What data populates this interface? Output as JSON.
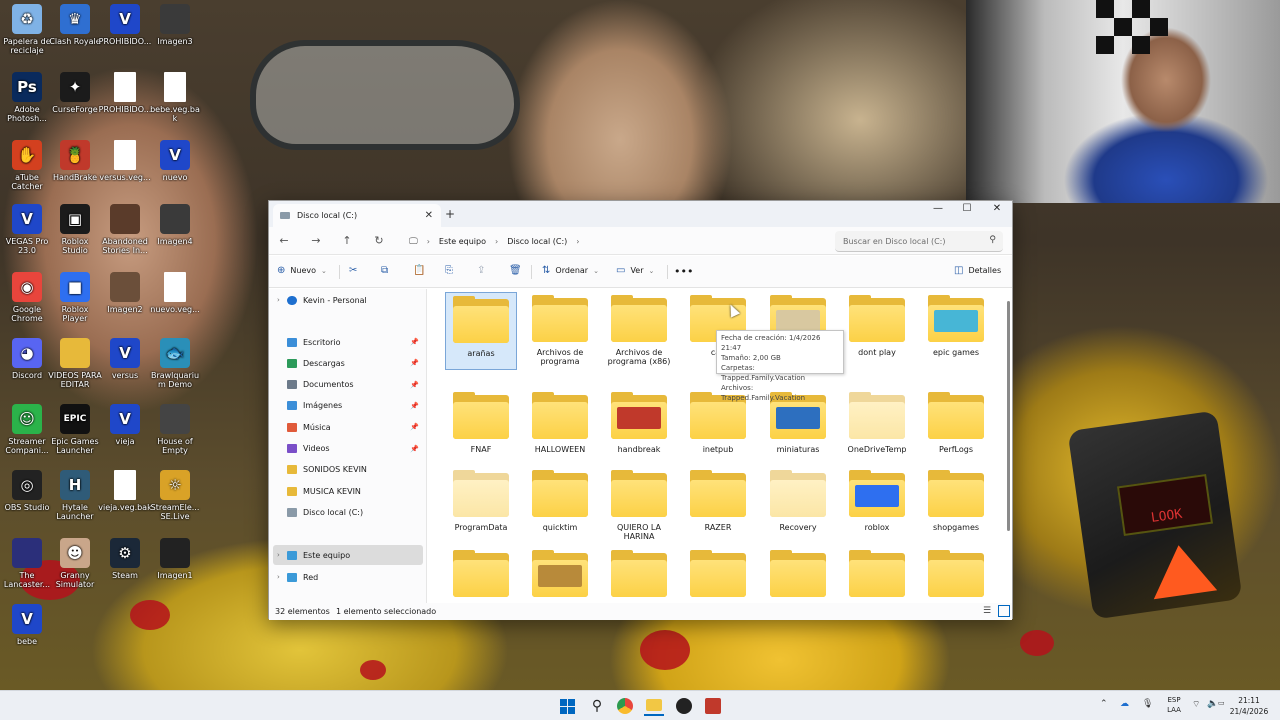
{
  "desktop": {
    "icons": [
      {
        "label": "Papelera de reciclaje",
        "icon": "recycle-bin-icon",
        "color": "#7fb2e6",
        "glyph": "♻"
      },
      {
        "label": "Clash Royale",
        "icon": "clash-royale-icon",
        "color": "#2f6fd1",
        "glyph": "♛"
      },
      {
        "label": "PROHIBIDO...",
        "icon": "vegas-project-icon",
        "color": "#1f47c9",
        "glyph": "V"
      },
      {
        "label": "Imagen3",
        "icon": "image-thumbnail-icon",
        "color": "#3a3a3a",
        "glyph": ""
      },
      {
        "label": "Adobe Photosh...",
        "icon": "photoshop-icon",
        "color": "#0a2a5c",
        "glyph": "Ps"
      },
      {
        "label": "CurseForge",
        "icon": "curseforge-icon",
        "color": "#1b1b1b",
        "glyph": "✦"
      },
      {
        "label": "PROHIBIDO...",
        "icon": "blank-file-icon",
        "color": "#ffffff",
        "glyph": ""
      },
      {
        "label": "bebe.veg.bak",
        "icon": "blank-file-icon",
        "color": "#ffffff",
        "glyph": ""
      },
      {
        "label": "aTube Catcher",
        "icon": "atube-catcher-icon",
        "color": "#d3401f",
        "glyph": "✋"
      },
      {
        "label": "HandBrake",
        "icon": "handbrake-icon",
        "color": "#c0392b",
        "glyph": "🍍"
      },
      {
        "label": "versus.veg...",
        "icon": "blank-file-icon",
        "color": "#ffffff",
        "glyph": ""
      },
      {
        "label": "nuevo",
        "icon": "vegas-project-icon",
        "color": "#1f47c9",
        "glyph": "V"
      },
      {
        "label": "VEGAS Pro 23.0",
        "icon": "vegas-pro-icon",
        "color": "#1f47c9",
        "glyph": "V"
      },
      {
        "label": "Roblox Studio",
        "icon": "roblox-studio-icon",
        "color": "#1b1b1b",
        "glyph": "▣"
      },
      {
        "label": "Abandoned Stories In...",
        "icon": "game-shortcut-icon",
        "color": "#5a3b2a",
        "glyph": ""
      },
      {
        "label": "Imagen4",
        "icon": "image-thumbnail-icon",
        "color": "#3a3a3a",
        "glyph": ""
      },
      {
        "label": "Google Chrome",
        "icon": "chrome-icon",
        "color": "#e8453c",
        "glyph": "◉"
      },
      {
        "label": "Roblox Player",
        "icon": "roblox-player-icon",
        "color": "#2e6ff0",
        "glyph": "■"
      },
      {
        "label": "Imagen2",
        "icon": "image-thumbnail-icon",
        "color": "#6b4f3a",
        "glyph": ""
      },
      {
        "label": "nuevo.veg...",
        "icon": "blank-file-icon",
        "color": "#ffffff",
        "glyph": ""
      },
      {
        "label": "Discord",
        "icon": "discord-icon",
        "color": "#5865f2",
        "glyph": "◕"
      },
      {
        "label": "VIDEOS PARA EDITAR",
        "icon": "folder-icon",
        "color": "#e7b93a",
        "glyph": ""
      },
      {
        "label": "versus",
        "icon": "vegas-project-icon",
        "color": "#1f47c9",
        "glyph": "V"
      },
      {
        "label": "Brawlquarium Demo",
        "icon": "brawlquarium-icon",
        "color": "#2a8fb8",
        "glyph": "🐟"
      },
      {
        "label": "Streamer Compani...",
        "icon": "streamer-companion-icon",
        "color": "#2bb34a",
        "glyph": "☺"
      },
      {
        "label": "Epic Games Launcher",
        "icon": "epic-games-icon",
        "color": "#111111",
        "glyph": "EPIC"
      },
      {
        "label": "vieja",
        "icon": "vegas-project-icon",
        "color": "#1f47c9",
        "glyph": "V"
      },
      {
        "label": "House of Empty Nam...",
        "icon": "game-shortcut-icon",
        "color": "#444444",
        "glyph": ""
      },
      {
        "label": "OBS Studio",
        "icon": "obs-icon",
        "color": "#222222",
        "glyph": "◎"
      },
      {
        "label": "Hytale Launcher",
        "icon": "hytale-icon",
        "color": "#2f5b78",
        "glyph": "H"
      },
      {
        "label": "vieja.veg.bak",
        "icon": "blank-file-icon",
        "color": "#ffffff",
        "glyph": ""
      },
      {
        "label": "StreamEle... SE.Live",
        "icon": "streamelements-icon",
        "color": "#d9a227",
        "glyph": "☼"
      },
      {
        "label": "The Lancaster...",
        "icon": "game-shortcut-icon",
        "color": "#2b2f7a",
        "glyph": ""
      },
      {
        "label": "Granny Simulator",
        "icon": "game-shortcut-icon",
        "color": "#c9a68a",
        "glyph": "☻"
      },
      {
        "label": "Steam",
        "icon": "steam-icon",
        "color": "#1b2838",
        "glyph": "⚙"
      },
      {
        "label": "Imagen1",
        "icon": "image-thumbnail-icon",
        "color": "#222222",
        "glyph": ""
      },
      {
        "label": "bebe",
        "icon": "vegas-project-icon",
        "color": "#1f47c9",
        "glyph": "V"
      }
    ]
  },
  "explorer": {
    "tab_title": "Disco local (C:)",
    "breadcrumb": [
      "Este equipo",
      "Disco local (C:)"
    ],
    "search_placeholder": "Buscar en Disco local (C:)",
    "toolbar": {
      "new_label": "Nuevo",
      "sort_label": "Ordenar",
      "view_label": "Ver",
      "details_label": "Detalles"
    },
    "nav": {
      "top_item": "Kevin - Personal",
      "quick": [
        {
          "label": "Escritorio",
          "color": "#3b8ed8",
          "pinned": true
        },
        {
          "label": "Descargas",
          "color": "#2c9a5a",
          "pinned": true
        },
        {
          "label": "Documentos",
          "color": "#6c7a8a",
          "pinned": true
        },
        {
          "label": "Imágenes",
          "color": "#3b8ed8",
          "pinned": true
        },
        {
          "label": "Música",
          "color": "#e05a3a",
          "pinned": true
        },
        {
          "label": "Videos",
          "color": "#7a4fc8",
          "pinned": true
        },
        {
          "label": "SONIDOS KEVIN",
          "color": "#e7b93a",
          "pinned": false
        },
        {
          "label": "MUSICA KEVIN",
          "color": "#e7b93a",
          "pinned": false
        },
        {
          "label": "Disco local (C:)",
          "color": "#8a9aa8",
          "pinned": false
        }
      ],
      "this_pc": "Este equipo",
      "network": "Red"
    },
    "items": [
      {
        "name": "arañas",
        "selected": true,
        "pale": false,
        "thumb": ""
      },
      {
        "name": "Archivos de programa",
        "selected": false,
        "pale": false,
        "thumb": ""
      },
      {
        "name": "Archivos de programa (x86)",
        "selected": false,
        "pale": false,
        "thumb": ""
      },
      {
        "name": "can",
        "selected": false,
        "pale": false,
        "thumb": ""
      },
      {
        "name": "",
        "selected": false,
        "pale": false,
        "thumb": "#d8c8a0"
      },
      {
        "name": "dont play",
        "selected": false,
        "pale": false,
        "thumb": ""
      },
      {
        "name": "epic games",
        "selected": false,
        "pale": false,
        "thumb": "#47b6d6"
      },
      {
        "name": "FNAF",
        "selected": false,
        "pale": false,
        "thumb": ""
      },
      {
        "name": "HALLOWEEN",
        "selected": false,
        "pale": false,
        "thumb": ""
      },
      {
        "name": "handbreak",
        "selected": false,
        "pale": false,
        "thumb": "#c0392b"
      },
      {
        "name": "inetpub",
        "selected": false,
        "pale": false,
        "thumb": ""
      },
      {
        "name": "miniaturas",
        "selected": false,
        "pale": false,
        "thumb": "#2d6fbf"
      },
      {
        "name": "OneDriveTemp",
        "selected": false,
        "pale": true,
        "thumb": ""
      },
      {
        "name": "PerfLogs",
        "selected": false,
        "pale": false,
        "thumb": ""
      },
      {
        "name": "ProgramData",
        "selected": false,
        "pale": true,
        "thumb": ""
      },
      {
        "name": "quicktim",
        "selected": false,
        "pale": false,
        "thumb": ""
      },
      {
        "name": "QUIERO LA HARINA",
        "selected": false,
        "pale": false,
        "thumb": ""
      },
      {
        "name": "RAZER",
        "selected": false,
        "pale": false,
        "thumb": ""
      },
      {
        "name": "Recovery",
        "selected": false,
        "pale": true,
        "thumb": ""
      },
      {
        "name": "roblox",
        "selected": false,
        "pale": false,
        "thumb": "#2e6ff0"
      },
      {
        "name": "shopgames",
        "selected": false,
        "pale": false,
        "thumb": ""
      },
      {
        "name": "",
        "selected": false,
        "pale": false,
        "thumb": ""
      },
      {
        "name": "",
        "selected": false,
        "pale": false,
        "thumb": "#b88a3a"
      },
      {
        "name": "",
        "selected": false,
        "pale": false,
        "thumb": ""
      },
      {
        "name": "",
        "selected": false,
        "pale": false,
        "thumb": ""
      },
      {
        "name": "",
        "selected": false,
        "pale": false,
        "thumb": ""
      },
      {
        "name": "",
        "selected": false,
        "pale": false,
        "thumb": ""
      },
      {
        "name": "",
        "selected": false,
        "pale": false,
        "thumb": ""
      }
    ],
    "tooltip": [
      "Fecha de creación: 1/4/2026 21:47",
      "Tamaño: 2,00 GB",
      "Carpetas: Trapped.Family.Vacation",
      "Archivos: Trapped.Family.Vacation"
    ],
    "status": {
      "count": "32 elementos",
      "selection": "1 elemento seleccionado"
    }
  },
  "wallpaper": {
    "scanner_text": "LOOK"
  },
  "taskbar": {
    "lang_line1": "ESP",
    "lang_line2": "LAA",
    "time": "21:11",
    "date": "21/4/2026",
    "accent": "#0067c0"
  }
}
